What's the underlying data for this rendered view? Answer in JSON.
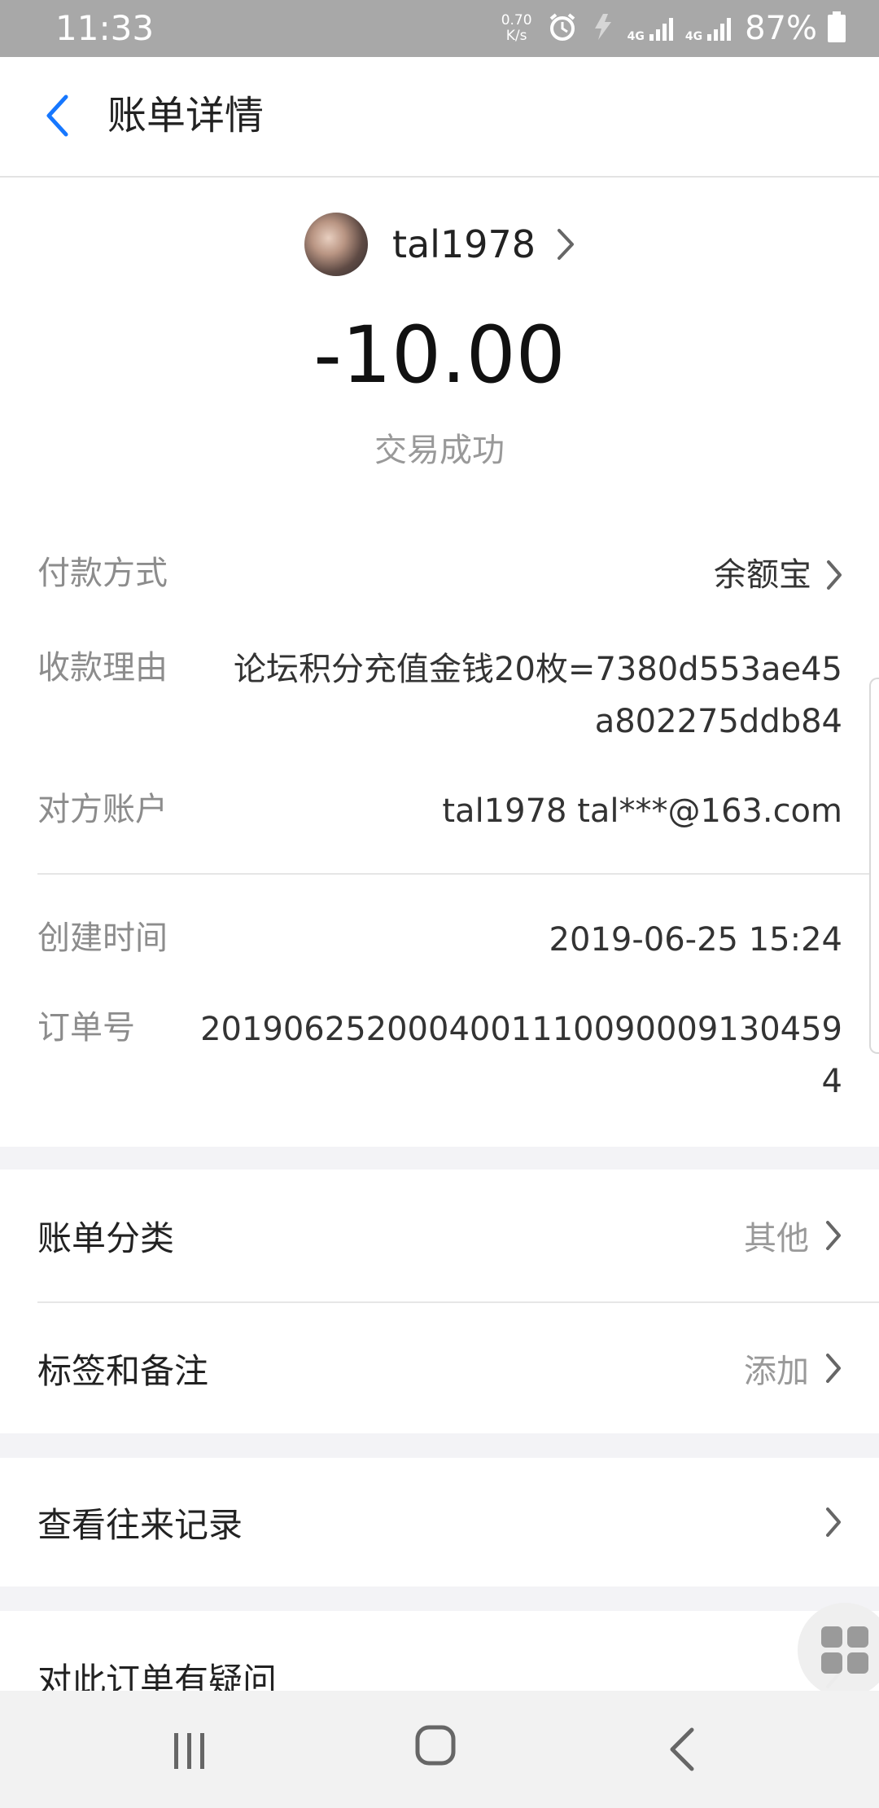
{
  "status_bar": {
    "time": "11:33",
    "net_speed_value": "0.70",
    "net_speed_unit": "K/s",
    "network_label_1": "4G",
    "network_label_2": "4G",
    "battery": "87%"
  },
  "header": {
    "title": "账单详情",
    "back_icon": "chevron-left-icon"
  },
  "payee": {
    "name": "tal1978"
  },
  "transaction": {
    "amount": "-10.00",
    "status": "交易成功"
  },
  "details": {
    "payment_method": {
      "label": "付款方式",
      "value": "余额宝"
    },
    "reason": {
      "label": "收款理由",
      "value_line1": "论坛积分充值金钱20枚=7380d553ae45",
      "value_line2": "a802275ddb84"
    },
    "counterparty": {
      "label": "对方账户",
      "value": "tal1978 tal***@163.com"
    },
    "created_time": {
      "label": "创建时间",
      "value": "2019-06-25 15:24"
    },
    "order_no": {
      "label": "订单号",
      "value_line1": "201906252000400111009000913045​9",
      "value_line2": "4"
    }
  },
  "options": {
    "category": {
      "label": "账单分类",
      "value": "其他"
    },
    "tags": {
      "label": "标签和备注",
      "value": "添加"
    },
    "history": {
      "label": "查看往来记录"
    },
    "question": {
      "label": "对此订单有疑问"
    }
  },
  "colors": {
    "accent": "#1677ff",
    "status_bar_bg": "#a8a8a8",
    "primary_text": "#222222",
    "secondary_text": "#8c8c8c",
    "page_bg": "#f3f3f6"
  }
}
